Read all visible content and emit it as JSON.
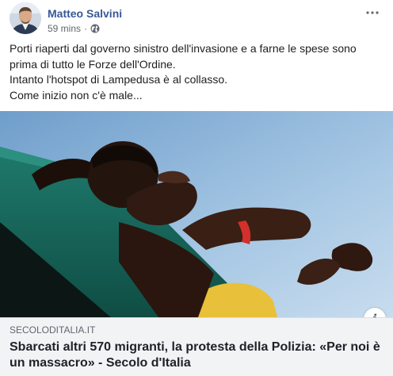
{
  "post": {
    "author": "Matteo Salvini",
    "time": "59 mins",
    "separator": "·",
    "privacy_icon": "globe-icon",
    "more_icon": "more-options-icon",
    "text_lines": [
      "Porti riaperti dal governo sinistro dell'invasione e a farne le spese sono",
      "prima di tutto le Forze dell'Ordine.",
      "Intanto l'hotspot di Lampedusa è al collasso.",
      "Come inizio non c'è male..."
    ]
  },
  "link_preview": {
    "domain": "SECOLODITALIA.IT",
    "title": "Sbarcati altri 570 migranti, la protesta della Polizia: «Per noi è un massacro» - Secolo d'Italia",
    "info_label": "i"
  },
  "colors": {
    "author_link": "#385898",
    "meta_text": "#616770",
    "link_box_bg": "#f2f3f5",
    "sky": "#8fb6d9",
    "hull_green": "#1a6b60"
  }
}
